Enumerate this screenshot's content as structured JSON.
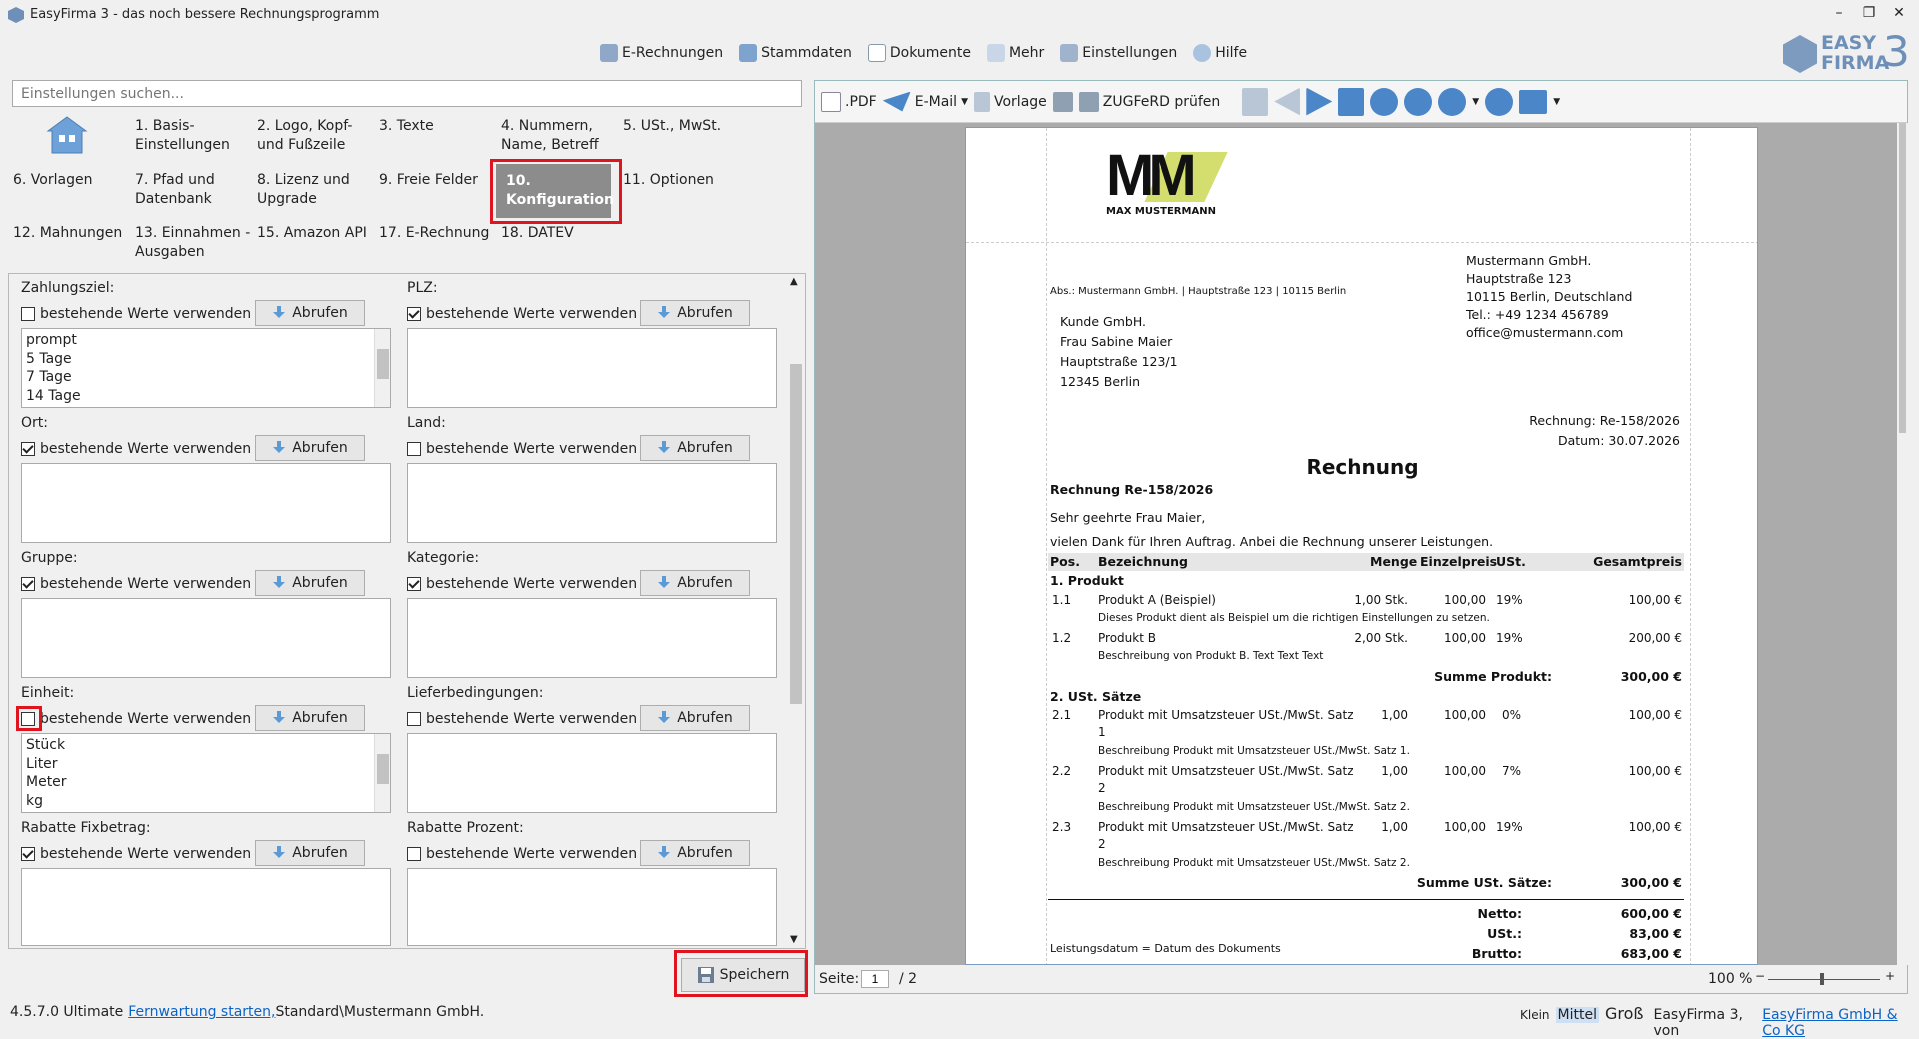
{
  "window": {
    "title": "EasyFirma 3 - das noch bessere Rechnungsprogramm",
    "min_icon": "–",
    "restore_icon": "❐",
    "close_icon": "✕"
  },
  "topnav": [
    {
      "label": "E-Rechnungen",
      "icon": "e-invoice-icon"
    },
    {
      "label": "Stammdaten",
      "icon": "database-icon"
    },
    {
      "label": "Dokumente",
      "icon": "document-icon"
    },
    {
      "label": "Mehr",
      "icon": "more-icon"
    },
    {
      "label": "Einstellungen",
      "icon": "settings-icon"
    },
    {
      "label": "Hilfe",
      "icon": "help-icon"
    }
  ],
  "logo": {
    "line1": "EASY",
    "line2": "FIRMA",
    "num": "3"
  },
  "search": {
    "placeholder": "Einstellungen suchen..."
  },
  "categories": {
    "c1": "1. Basis-\nEinstellungen",
    "c2": "2. Logo, Kopf-\nund Fußzeile",
    "c3": "3. Texte",
    "c4": "4. Nummern,\nName, Betreff",
    "c5": "5. USt., MwSt.",
    "c6": "6. Vorlagen",
    "c7": "7. Pfad und\nDatenbank",
    "c8": "8. Lizenz und\nUpgrade",
    "c9": "9. Freie Felder",
    "c10": "10. Konfiguration",
    "c11": "11. Optionen",
    "c12": "12. Mahnungen",
    "c13": "13. Einnahmen -\nAusgaben",
    "c15": "15. Amazon API",
    "c17": "17. E-Rechnung",
    "c18": "18. DATEV"
  },
  "fields": {
    "zahlungsziel": {
      "label": "Zahlungsziel:",
      "checked": false,
      "items": [
        "prompt",
        "5 Tage",
        "7 Tage",
        "14 Tage"
      ]
    },
    "plz": {
      "label": "PLZ:",
      "checked": true,
      "items": []
    },
    "ort": {
      "label": "Ort:",
      "checked": true,
      "items": []
    },
    "land": {
      "label": "Land:",
      "checked": false,
      "items": []
    },
    "gruppe": {
      "label": "Gruppe:",
      "checked": true,
      "items": []
    },
    "kategorie": {
      "label": "Kategorie:",
      "checked": true,
      "items": []
    },
    "einheit": {
      "label": "Einheit:",
      "checked": false,
      "items": [
        "Stück",
        "Liter",
        "Meter",
        "kg"
      ]
    },
    "lieferbedingungen": {
      "label": "Lieferbedingungen:",
      "checked": false,
      "items": []
    },
    "rabatte_fix": {
      "label": "Rabatte Fixbetrag:",
      "checked": true,
      "items": []
    },
    "rabatte_prozent": {
      "label": "Rabatte Prozent:",
      "checked": false,
      "items": []
    }
  },
  "common": {
    "use_existing": "bestehende Werte verwenden",
    "fetch": "Abrufen"
  },
  "save_label": "Speichern",
  "status": {
    "version": "4.5.7.0 Ultimate",
    "remote": "Fernwartung starten,",
    "path": "Standard\\Mustermann GmbH.",
    "klein": "Klein",
    "mittel": "Mittel",
    "gross": "Groß",
    "credit": "EasyFirma 3, von",
    "company_link": "EasyFirma GmbH & Co KG"
  },
  "preview_toolbar": {
    "pdf": ".PDF",
    "email": "E-Mail",
    "vorlage": "Vorlage",
    "zugferd": "ZUGFeRD prüfen"
  },
  "pager": {
    "label": "Seite:",
    "current": "1",
    "total": "/ 2",
    "zoom": "100 %"
  },
  "invoice": {
    "logo_text": "MM",
    "logo_sub": "MAX MUSTERMANN",
    "sender_line": "Abs.: Mustermann GmbH. | Hauptstraße 123 | 10115 Berlin",
    "company": [
      "Mustermann GmbH.",
      "Hauptstraße 123",
      "10115 Berlin, Deutschland",
      "Tel.: +49 1234 456789",
      "office@mustermann.com"
    ],
    "recipient": [
      "Kunde GmbH.",
      "Frau Sabine Maier",
      "Hauptstraße 123/1",
      "12345 Berlin"
    ],
    "meta_invoice": "Rechnung: Re-158/2026",
    "meta_date": "Datum: 30.07.2026",
    "title": "Rechnung",
    "subject": "Rechnung Re-158/2026",
    "greeting": "Sehr geehrte Frau Maier,",
    "intro": "vielen Dank für Ihren Auftrag. Anbei die Rechnung unserer Leistungen.",
    "headers": {
      "pos": "Pos.",
      "bez": "Bezeichnung",
      "menge": "Menge",
      "ep": "Einzelpreis",
      "ust": "USt.",
      "gp": "Gesamtpreis"
    },
    "sec1": "1. Produkt",
    "r11": {
      "pos": "1.1",
      "bez": "Produkt A (Beispiel)",
      "menge": "1,00 Stk.",
      "ep": "100,00",
      "ust": "19%",
      "gp": "100,00 €",
      "desc": "Dieses Produkt dient als Beispiel um die richtigen Einstellungen zu setzen."
    },
    "r12": {
      "pos": "1.2",
      "bez": "Produkt B",
      "menge": "2,00 Stk.",
      "ep": "100,00",
      "ust": "19%",
      "gp": "200,00 €",
      "desc": "Beschreibung von Produkt B. Text Text Text"
    },
    "sum1_label": "Summe Produkt:",
    "sum1": "300,00 €",
    "sec2": "2. USt. Sätze",
    "r21": {
      "pos": "2.1",
      "bez1": "Produkt mit Umsatzsteuer USt./MwSt. Satz",
      "bez2": "1",
      "menge": "1,00",
      "ep": "100,00",
      "ust": "0%",
      "gp": "100,00 €",
      "desc": "Beschreibung Produkt mit Umsatzsteuer USt./MwSt. Satz 1."
    },
    "r22": {
      "pos": "2.2",
      "bez1": "Produkt mit Umsatzsteuer USt./MwSt. Satz",
      "bez2": "2",
      "menge": "1,00",
      "ep": "100,00",
      "ust": "7%",
      "gp": "100,00 €",
      "desc": "Beschreibung Produkt mit Umsatzsteuer USt./MwSt. Satz 2."
    },
    "r23": {
      "pos": "2.3",
      "bez1": "Produkt mit Umsatzsteuer USt./MwSt. Satz",
      "bez2": "2",
      "menge": "1,00",
      "ep": "100,00",
      "ust": "19%",
      "gp": "100,00 €",
      "desc": "Beschreibung Produkt mit Umsatzsteuer USt./MwSt. Satz 2."
    },
    "sum2_label": "Summe USt. Sätze:",
    "sum2": "300,00 €",
    "netto_label": "Netto:",
    "netto": "600,00 €",
    "ust_label": "USt.:",
    "ust": "83,00 €",
    "brutto_label": "Brutto:",
    "brutto": "683,00 €",
    "leistung": "Leistungsdatum = Datum des Dokuments"
  }
}
